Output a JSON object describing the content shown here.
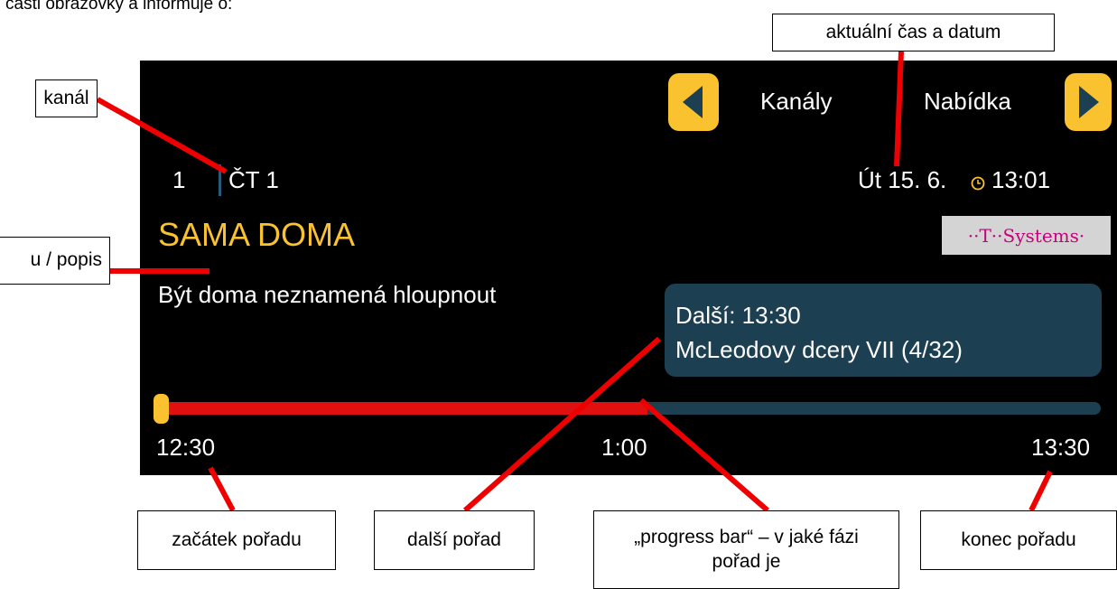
{
  "document": {
    "text_top": "části obrazovky a informuje o:"
  },
  "screen": {
    "nav": {
      "left_label": "Kanály",
      "right_label": "Nabídka",
      "left_icon": "arrow-left-icon",
      "right_icon": "arrow-right-icon"
    },
    "channel": {
      "number": "1",
      "name": "ČT 1"
    },
    "datetime": {
      "date": "Út 15. 6.",
      "clock_icon": "clock-icon",
      "time": "13:01"
    },
    "logo": {
      "text": "··T··Systems·"
    },
    "program": {
      "title": "SAMA DOMA",
      "description": "Být doma neznamená hloupnout"
    },
    "next": {
      "line1": "Další: 13:30",
      "line2": "McLeodovy dcery VII (4/32)"
    },
    "progress": {
      "start": "12:30",
      "middle": "1:00",
      "end": "13:30",
      "fraction": 0.52
    },
    "colors": {
      "accent": "#f9c22e",
      "panel": "#1d3f52",
      "title": "#f9c22e",
      "progress": "#e01010"
    }
  },
  "callouts": {
    "kanal": "kanál",
    "datetime": "aktuální čas a datum",
    "title_desc": "u / popis",
    "start": "začátek pořadu",
    "next": "další pořad",
    "progress": "„progress bar“ – v jaké fázi pořad je",
    "end": "konec pořadu"
  }
}
